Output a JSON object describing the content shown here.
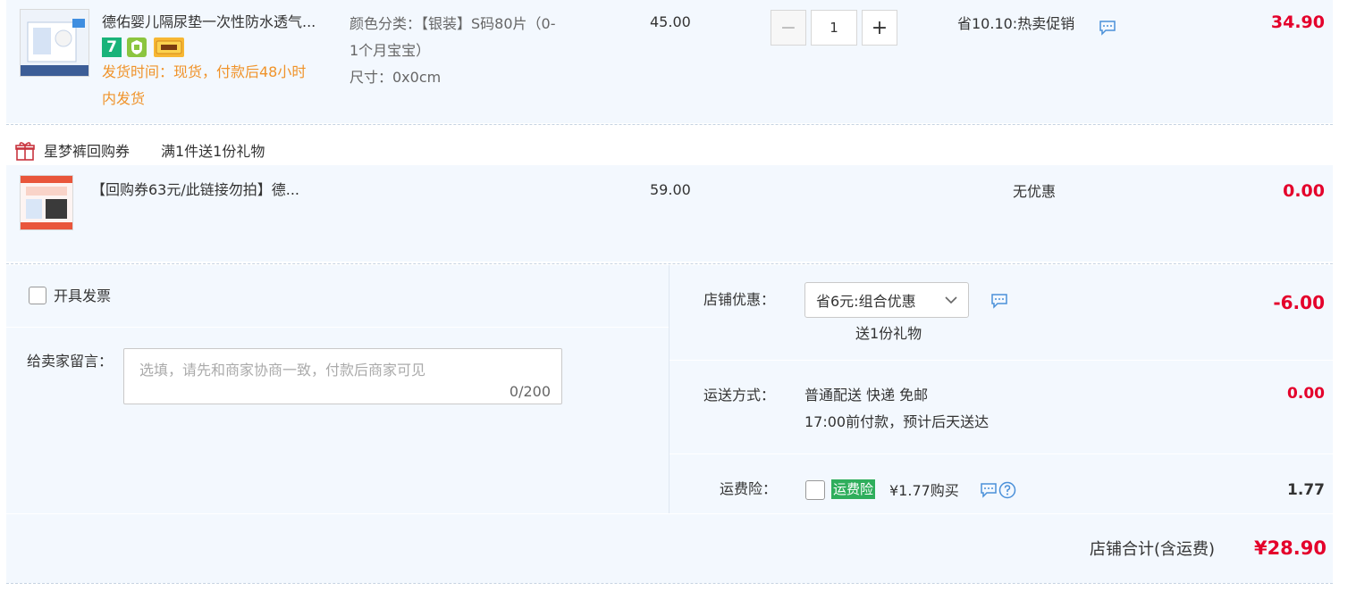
{
  "item1": {
    "title": "德佑婴儿隔尿垫一次性防水透气...",
    "delivery_line1": "发货时间：现货，付款后48小时",
    "delivery_line2": "内发货",
    "spec_line1": "颜色分类：【银装】S码80片（0-",
    "spec_line2": "1个月宝宝）",
    "spec_line3": "尺寸：0x0cm",
    "price": "45.00",
    "quantity": "1",
    "minus": "−",
    "plus": "+",
    "promo": "省10.10:热卖促销",
    "subtotal": "34.90"
  },
  "gift": {
    "name": "星梦裤回购券",
    "rule": "满1件送1份礼物"
  },
  "item2": {
    "title": "【回购券63元/此链接勿拍】德...",
    "price": "59.00",
    "promo": "无优惠",
    "subtotal": "0.00"
  },
  "invoice": {
    "label": "开具发票"
  },
  "message": {
    "label": "给卖家留言：",
    "placeholder": "选填，请先和商家协商一致，付款后商家可见",
    "counter": "0/200"
  },
  "shop_discount": {
    "label": "店铺优惠：",
    "selected": "省6元:组合优惠",
    "note": "送1份礼物",
    "amount": "-6.00"
  },
  "shipping": {
    "label": "运送方式：",
    "method": "普通配送 快递 免邮",
    "eta": "17:00前付款，预计后天送达",
    "amount": "0.00"
  },
  "insurance": {
    "label": "运费险：",
    "badge": "运费险",
    "price_text": "¥1.77购买",
    "amount": "1.77"
  },
  "total": {
    "label": "店铺合计(含运费)",
    "amount": "¥28.90"
  },
  "colors": {
    "accent_red": "#e4002b",
    "orange": "#f0932a",
    "panel": "#f3f8fe",
    "green": "#2fae5c",
    "icon_blue": "#4a90d9"
  },
  "icons": [
    "chat-icon",
    "gift-icon",
    "chevron-down-icon",
    "help-icon",
    "tmall-7-icon",
    "shield-icon",
    "card-icon"
  ]
}
